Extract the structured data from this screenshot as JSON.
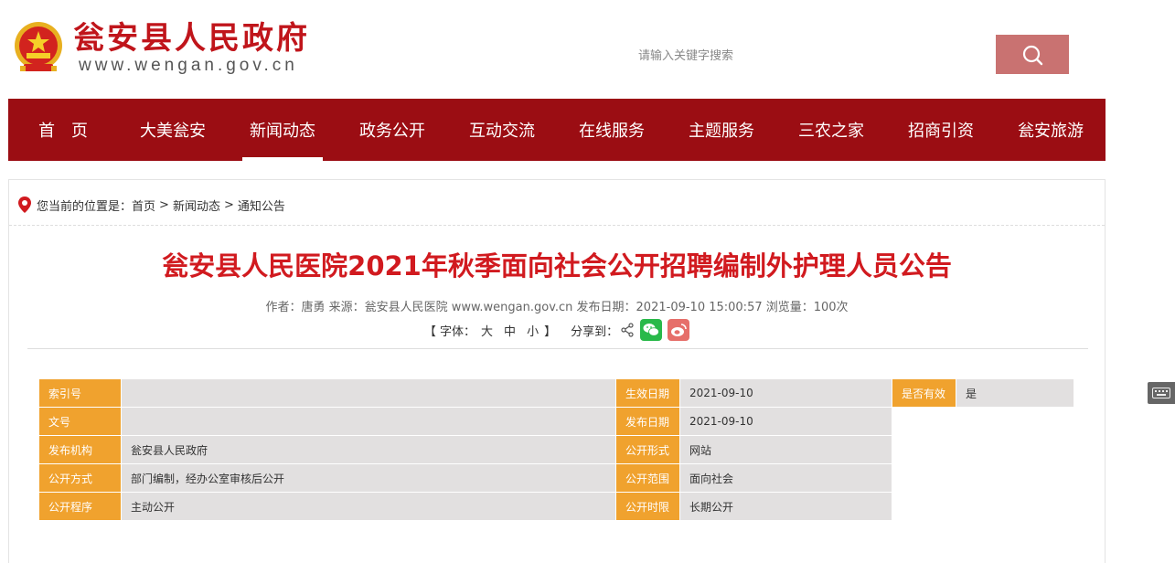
{
  "header": {
    "site_title": "瓮安县人民政府",
    "site_url": "www.wengan.gov.cn",
    "search_placeholder": "请输入关键字搜索"
  },
  "nav": {
    "items": [
      "首　页",
      "大美瓮安",
      "新闻动态",
      "政务公开",
      "互动交流",
      "在线服务",
      "主题服务",
      "三农之家",
      "招商引资",
      "瓮安旅游"
    ],
    "active_index": 2
  },
  "breadcrumb": {
    "prefix": "您当前的位置是：",
    "items": [
      "首页",
      "新闻动态",
      "通知公告"
    ],
    "separator": ">"
  },
  "article": {
    "title": "瓮安县人民医院2021年秋季面向社会公开招聘编制外护理人员公告",
    "meta": "作者：唐勇 来源：瓮安县人民医院 www.wengan.gov.cn 发布日期：2021-09-10 15:00:57 浏览量：100次",
    "font_label_open": "【 字体：",
    "font_sizes": [
      "大",
      "中",
      "小"
    ],
    "font_label_close": "】",
    "share_label": "分享到："
  },
  "info_table": {
    "rows": [
      [
        {
          "k": "索引号",
          "v": ""
        },
        {
          "k": "生效日期",
          "v": "2021-09-10"
        },
        {
          "k": "是否有效",
          "v": "是"
        }
      ],
      [
        {
          "k": "文号",
          "v": ""
        },
        {
          "k": "发布日期",
          "v": "2021-09-10"
        }
      ],
      [
        {
          "k": "发布机构",
          "v": "瓮安县人民政府"
        },
        {
          "k": "公开形式",
          "v": "网站"
        }
      ],
      [
        {
          "k": "公开方式",
          "v": "部门编制，经办公室审核后公开"
        },
        {
          "k": "公开范围",
          "v": "面向社会"
        }
      ],
      [
        {
          "k": "公开程序",
          "v": "主动公开"
        },
        {
          "k": "公开时限",
          "v": "长期公开"
        }
      ]
    ]
  },
  "colors": {
    "brand_red": "#c0151b",
    "nav_bg": "#9b0d13",
    "title_red": "#d11a1f",
    "key_orange": "#f0a22e",
    "value_gray": "#e2e0e0",
    "search_button": "#c97271",
    "wechat_green": "#29b94a",
    "weibo_red": "#e66f6a"
  },
  "icons": [
    "national-emblem-icon",
    "search-icon",
    "location-pin-icon",
    "share-icon",
    "wechat-icon",
    "weibo-icon",
    "keyboard-icon"
  ]
}
